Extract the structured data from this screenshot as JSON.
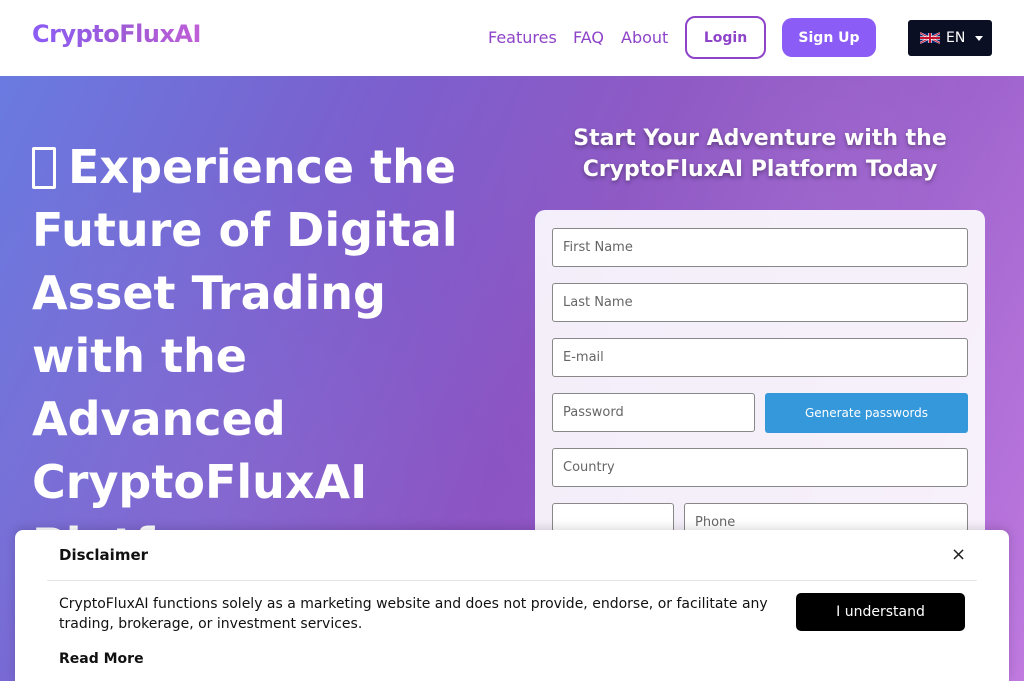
{
  "header": {
    "logo_text": "CryptoFluxAI",
    "nav": {
      "features": "Features",
      "faq": "FAQ",
      "about": "About"
    },
    "login_label": "Login",
    "signup_label": "Sign Up",
    "language": {
      "code": "EN",
      "flag_icon": "uk-flag-icon"
    }
  },
  "hero": {
    "headline": "Experience the Future of Digital Asset Trading with the Advanced CryptoFluxAI Platform",
    "form_title": "Start Your Adventure with the CryptoFluxAI Platform Today",
    "form": {
      "first_name_placeholder": "First Name",
      "last_name_placeholder": "Last Name",
      "email_placeholder": "E-mail",
      "password_placeholder": "Password",
      "generate_label": "Generate passwords",
      "country_placeholder": "Country",
      "phone_prefix_value": "",
      "phone_placeholder": "Phone"
    }
  },
  "disclaimer": {
    "title": "Disclaimer",
    "close_label": "×",
    "text": "CryptoFluxAI functions solely as a marketing website and does not provide, endorse, or facilitate any trading, brokerage, or investment services.",
    "read_more": "Read More",
    "understand_label": "I understand"
  },
  "colors": {
    "accent": "#8b5cf6",
    "nav_text": "#8e44c9",
    "generate_button": "#3498db",
    "lang_bg": "#0b0f24"
  }
}
